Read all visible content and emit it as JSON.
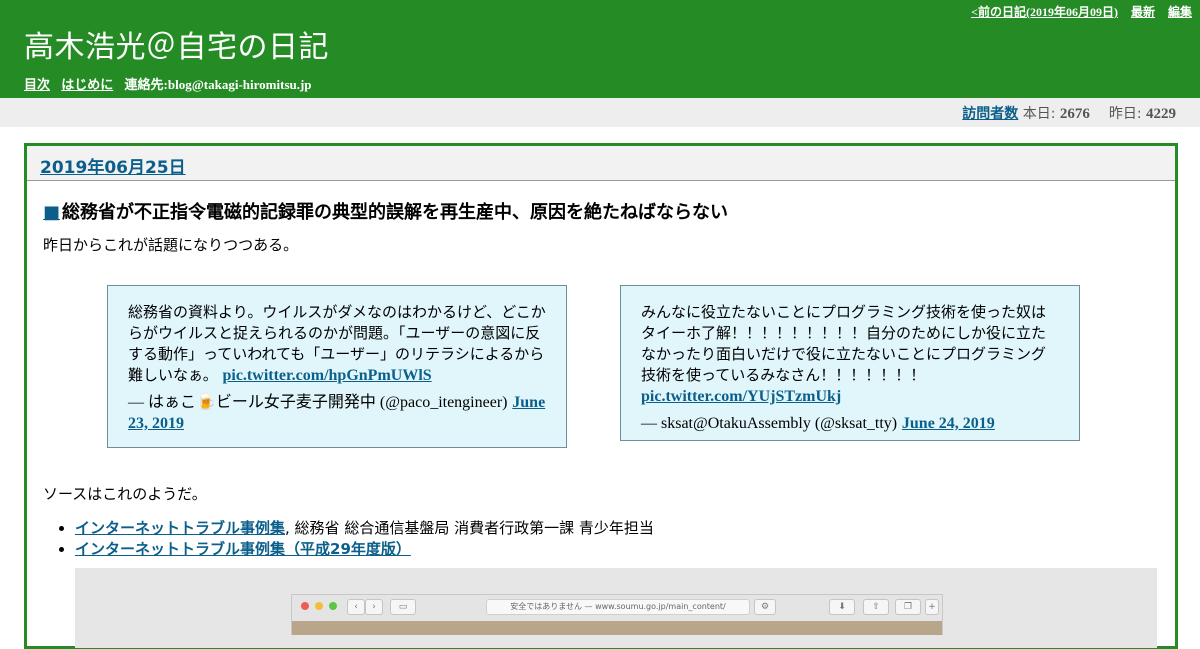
{
  "header": {
    "nav_prev": "<前の日記(2019年06月09日)",
    "nav_latest": "最新",
    "nav_edit": "編集",
    "title": "高木浩光＠自宅の日記",
    "links": [
      "目次",
      "はじめに"
    ],
    "contact": "連絡先:blog@takagi-hiromitsu.jp",
    "bg_color": "#258c25"
  },
  "visitors": {
    "label": "訪問者数",
    "today_label": "本日:",
    "today_value": "2676",
    "yesterday_label": "昨日:",
    "yesterday_value": "4229"
  },
  "day": {
    "date": "2019年06月25日",
    "section_marker": "■",
    "section_title": "総務省が不正指令電磁的記録罪の典型的誤解を再生産中、原因を絶たねばならない",
    "intro": "昨日からこれが話題になりつつある。",
    "after_tweets": "ソースはこれのようだ。"
  },
  "tweets": [
    {
      "text": "総務省の資料より。ウイルスがダメなのはわかるけど、どこからがウイルスと捉えられるのかが問題。「ユーザーの意図に反する動作」っていわれても「ユーザー」のリテラシによるから難しいなぁ。",
      "link": "pic.twitter.com/hpGnPmUWlS",
      "author": "— はぁこ🍺ビール女子麦子開発中 (@paco_itengineer)",
      "date": "June 23, 2019"
    },
    {
      "text": "みんなに役立たないことにプログラミング技術を使った奴はタイーホ了解！！！！！！！！！自分のためにしか役に立たなかったり面白いだけで役に立たないことにプログラミング技術を使っているみなさん！！！！！！！",
      "link": "pic.twitter.com/YUjSTzmUkj",
      "author": "— sksat@OtakuAssembly (@sksat_tty)",
      "date": "June 24, 2019"
    }
  ],
  "sources": [
    {
      "link": "インターネットトラブル事例集",
      "suffix": ", 総務省 総合通信基盤局 消費者行政第一課 青少年担当"
    },
    {
      "link": "インターネットトラブル事例集（平成29年度版）",
      "suffix": ""
    }
  ],
  "browser": {
    "url": "安全ではありません — www.soumu.go.jp/main_content/"
  },
  "colors": {
    "link": "#0b5f8a",
    "tweet_bg": "#e0f6fb",
    "visitor_bg": "#eeeeee"
  }
}
